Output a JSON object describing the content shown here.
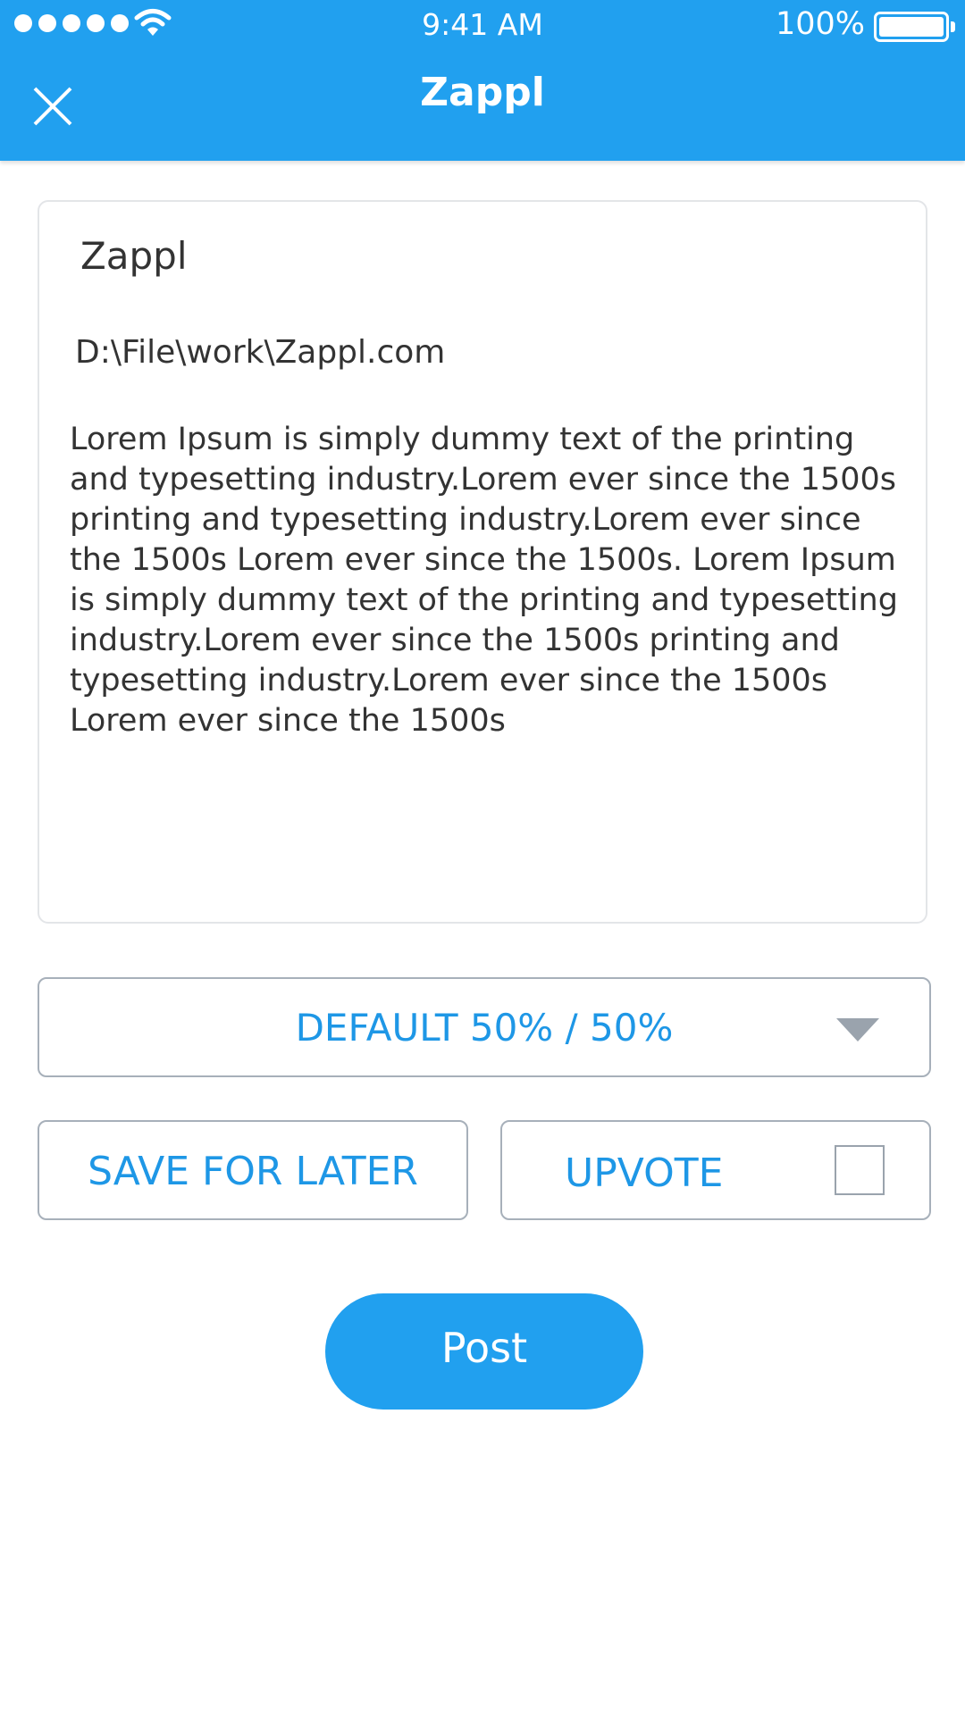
{
  "status_bar": {
    "time": "9:41 AM",
    "battery": "100%",
    "signal_icon": "signal-dots-icon",
    "wifi_icon": "wifi-icon",
    "battery_icon": "battery-icon"
  },
  "header": {
    "title": "Zappl",
    "close_icon": "close-icon",
    "background_color": "#21a0ef"
  },
  "post": {
    "title": "Zappl",
    "path": "D:\\File\\work\\Zappl.com",
    "body": "Lorem Ipsum is simply dummy text of the printing and typesetting industry.Lorem  ever since the 1500s printing and typesetting industry.Lorem  ever since the 1500s Lorem  ever since the 1500s. Lorem Ipsum is simply dummy text of the printing and typesetting industry.Lorem  ever since the 1500s printing and typesetting industry.Lorem  ever since the 1500s Lorem  ever since the 1500s"
  },
  "split_select": {
    "selected": "DEFAULT 50% / 50%",
    "caret_icon": "caret-down-icon"
  },
  "actions": {
    "save_for_later": "SAVE FOR LATER",
    "upvote": "UPVOTE",
    "upvote_checked": false,
    "post": "Post"
  },
  "colors": {
    "accent": "#21a0ef",
    "link_text": "#1e97e6",
    "border": "#a7b0ba"
  }
}
